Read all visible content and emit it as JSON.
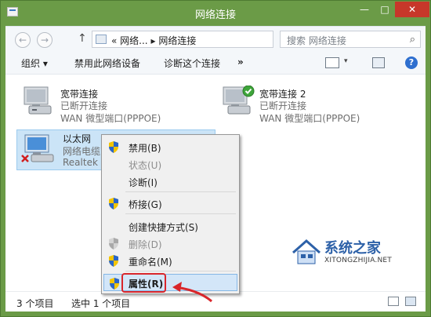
{
  "window": {
    "title": "网络连接"
  },
  "titlebar": {
    "minimize": "—",
    "maximize": "□",
    "close": "✕"
  },
  "nav": {
    "address_prefix": "«",
    "breadcrumb_1": "网络...",
    "breadcrumb_sep": "▸",
    "breadcrumb_2": "网络连接",
    "search_placeholder": "搜索 网络连接"
  },
  "toolbar": {
    "organize": "组织 ▾",
    "disable_device": "禁用此网络设备",
    "diagnose": "诊断这个连接",
    "more": "»"
  },
  "connections": [
    {
      "name": "宽带连接",
      "status": "已断开连接",
      "device": "WAN 微型端口(PPPOE)",
      "state": "disconnected"
    },
    {
      "name": "宽带连接 2",
      "status": "已断开连接",
      "device": "WAN 微型端口(PPPOE)",
      "state": "default"
    },
    {
      "name": "以太网",
      "status": "网络电缆",
      "device": "Realtek",
      "state": "cable-unplugged"
    }
  ],
  "context_menu": {
    "items": [
      {
        "label": "禁用(B)",
        "shield": true,
        "disabled": false
      },
      {
        "label": "状态(U)",
        "shield": false,
        "disabled": true
      },
      {
        "label": "诊断(I)",
        "shield": false,
        "disabled": false
      },
      {
        "label": "桥接(G)",
        "shield": true,
        "disabled": false
      },
      {
        "label": "创建快捷方式(S)",
        "shield": false,
        "disabled": false
      },
      {
        "label": "删除(D)",
        "shield": true,
        "disabled": true
      },
      {
        "label": "重命名(M)",
        "shield": true,
        "disabled": false
      },
      {
        "label": "属性(R)",
        "shield": true,
        "disabled": false,
        "highlighted": true
      }
    ]
  },
  "statusbar": {
    "item_count": "3 个项目",
    "selected": "选中 1 个项目"
  },
  "watermark": {
    "title": "系统之家",
    "url": "XITONGZHIJIA.NET"
  },
  "colors": {
    "titlebar": "#6b9b47",
    "close_button": "#c7372a",
    "selection": "#cbe4f7",
    "highlight_border": "#d9262b"
  }
}
